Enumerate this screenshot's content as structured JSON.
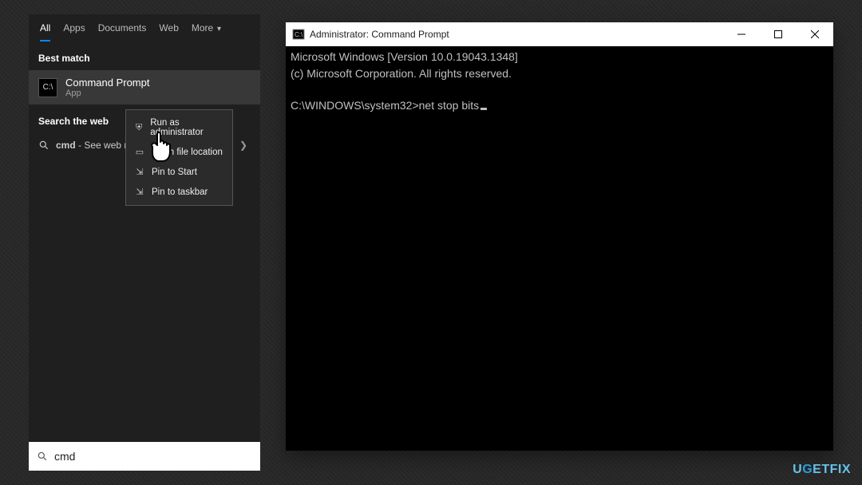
{
  "search": {
    "tabs": {
      "all": "All",
      "apps": "Apps",
      "documents": "Documents",
      "web": "Web",
      "more": "More"
    },
    "best_match_label": "Best match",
    "result": {
      "title": "Command Prompt",
      "subtitle": "App"
    },
    "search_web_label": "Search the web",
    "web_query_prefix": "cmd",
    "web_query_suffix": " - See web results",
    "input_value": "cmd"
  },
  "context_menu": {
    "run_admin": "Run as administrator",
    "open_location": "Open file location",
    "pin_start": "Pin to Start",
    "pin_taskbar": "Pin to taskbar"
  },
  "cmd_window": {
    "title": "Administrator: Command Prompt",
    "line1": "Microsoft Windows [Version 10.0.19043.1348]",
    "line2": "(c) Microsoft Corporation. All rights reserved.",
    "prompt": "C:\\WINDOWS\\system32>",
    "command": "net stop bits"
  },
  "watermark": "UGETFIX"
}
